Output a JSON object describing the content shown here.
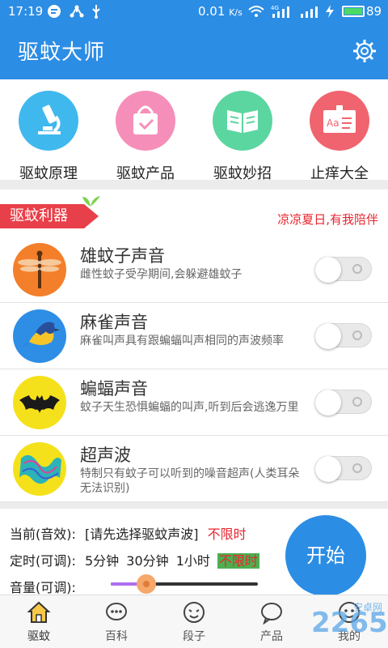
{
  "status": {
    "time": "17:19",
    "net_speed": "0.01",
    "net_unit": "K/s",
    "battery": "89",
    "network": "4G"
  },
  "appbar": {
    "title": "驱蚊大师"
  },
  "categories": [
    {
      "label": "驱蚊原理",
      "icon": "microscope-icon",
      "color": "#3fb8ee"
    },
    {
      "label": "驱蚊产品",
      "icon": "shopping-bag-icon",
      "color": "#f58fba"
    },
    {
      "label": "驱蚊妙招",
      "icon": "book-icon",
      "color": "#5bd6a0"
    },
    {
      "label": "止痒大全",
      "icon": "board-icon",
      "color": "#f0646f"
    }
  ],
  "section": {
    "ribbon": "驱蚊利器",
    "slogan": "凉凉夏日,有我陪伴"
  },
  "sounds": [
    {
      "title": "雄蚊子声音",
      "desc": "雌性蚊子受孕期间,会躲避雄蚊子",
      "enabled": false
    },
    {
      "title": "麻雀声音",
      "desc": "麻雀叫声具有跟蝙蝠叫声相同的声波频率",
      "enabled": false
    },
    {
      "title": "蝙蝠声音",
      "desc": "蚊子天生恐惧蝙蝠的叫声,听到后会逃逸万里",
      "enabled": false
    },
    {
      "title": "超声波",
      "desc": "特制只有蚊子可以听到的噪音超声(人类耳朵无法识别)",
      "enabled": false
    }
  ],
  "control": {
    "current_label": "当前(音效):",
    "current_value": "[请先选择驱蚊声波]",
    "current_duration": "不限时",
    "timer_label": "定时(可调):",
    "timer_options": [
      "5分钟",
      "30分钟",
      "1小时",
      "不限时"
    ],
    "timer_selected": 3,
    "volume_label": "音量(可调):",
    "volume": 0.24,
    "start_label": "开始"
  },
  "tabs": [
    {
      "label": "驱蚊",
      "active": true
    },
    {
      "label": "百科",
      "active": false
    },
    {
      "label": "段子",
      "active": false
    },
    {
      "label": "产品",
      "active": false
    },
    {
      "label": "我的",
      "active": false
    }
  ],
  "watermark": {
    "text": "2265",
    "sub": "安卓网"
  }
}
